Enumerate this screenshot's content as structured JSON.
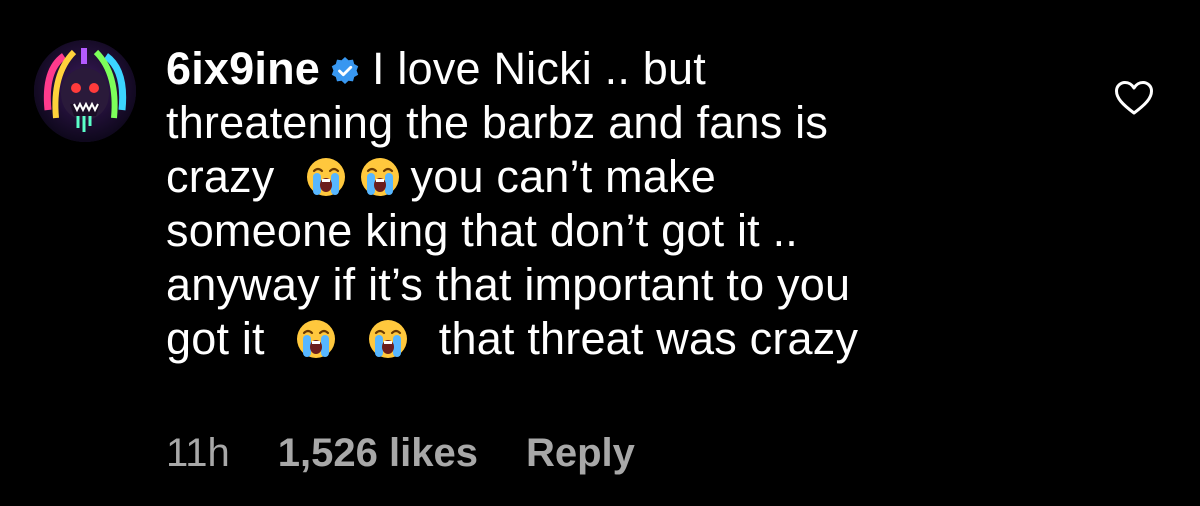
{
  "comment": {
    "username": "6ix9ine",
    "verified": true,
    "lines": [
      "I love Nicki .. but",
      "threatening the barbz and fans is",
      "crazy",
      "you can’t make",
      "someone king that don’t got it ..",
      "anyway if it’s that important to you",
      "got it",
      "that threat was crazy"
    ],
    "emoji": "loudly-crying-face",
    "time": "11h",
    "likes": "1,526 likes",
    "reply_label": "Reply"
  },
  "icons": {
    "like": "heart-outline-icon",
    "verified": "verified-badge-icon"
  },
  "colors": {
    "background": "#000000",
    "text": "#ffffff",
    "meta": "#a8a8a8",
    "verified": "#3897f0"
  }
}
